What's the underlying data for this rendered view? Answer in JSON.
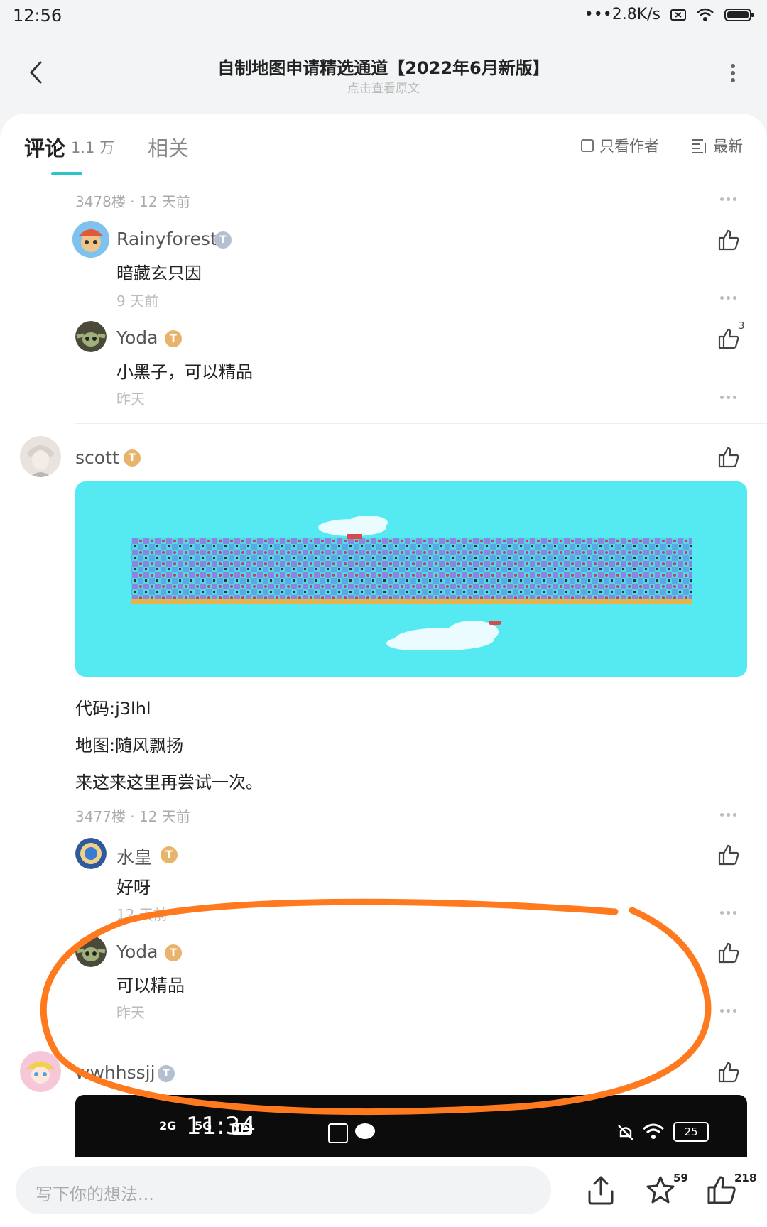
{
  "status_bar": {
    "time": "12:56",
    "network_speed": "2.8K/s"
  },
  "header": {
    "title": "自制地图申请精选通道【2022年6月新版】",
    "subtitle": "点击查看原文"
  },
  "tabs": {
    "comments_label": "评论",
    "comments_count": "1.1 万",
    "related_label": "相关",
    "only_author_label": "只看作者",
    "sort_label": "最新"
  },
  "thread_top": {
    "floor_meta": "3478楼 · 12 天前",
    "replies": [
      {
        "user": "Rainyforest",
        "badge": "T",
        "badge_color": "silver",
        "text": "暗藏玄只因",
        "time": "9 天前",
        "likes": ""
      },
      {
        "user": "Yoda",
        "badge": "T",
        "badge_color": "gold",
        "text": "小黑子，可以精品",
        "time": "昨天",
        "likes": "3"
      }
    ]
  },
  "post": {
    "user": "scott",
    "badge": "T",
    "lines": [
      "代码:j3lhl",
      "地图:随风飘扬",
      "来这来这里再尝试一次。"
    ],
    "floor_meta": "3477楼 · 12 天前",
    "replies": [
      {
        "user": "水皇",
        "badge": "T",
        "badge_color": "gold",
        "text": "好呀",
        "time": "12 天前"
      },
      {
        "user": "Yoda",
        "badge": "T",
        "badge_color": "gold",
        "text": "可以精品",
        "time": "昨天"
      }
    ]
  },
  "next_post": {
    "user": "wwhhssjj",
    "badge": "T",
    "embedded_screenshot": {
      "network_a": "2G",
      "network_b": "5G",
      "hd_label": "HD",
      "time": "11:34",
      "battery": "25"
    }
  },
  "bottom_bar": {
    "input_placeholder": "写下你的想法...",
    "star_count": "59",
    "like_count": "218"
  },
  "colors": {
    "accent": "#2bc4c9",
    "annotation": "#ff7a1f",
    "map_bg": "#55eaf2"
  }
}
